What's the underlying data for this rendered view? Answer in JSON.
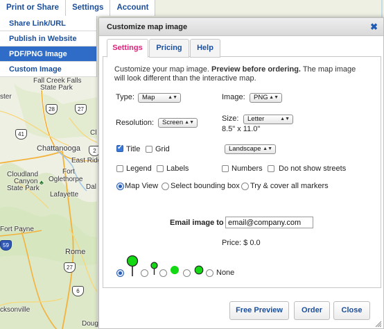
{
  "topnav": [
    "Print or Share",
    "Settings",
    "Account"
  ],
  "share_menu": [
    "Share Link/URL",
    "Publish in Website",
    "PDF/PNG Image",
    "Custom Image"
  ],
  "map_labels": {
    "fall_creek": "Fall Creek Falls",
    "state_park": "State Park",
    "ster": "ster",
    "chattanooga": "Chattanooga",
    "east_ridge": "East Ridg",
    "cloudland": "Cloudland",
    "canyon": "Canyon",
    "cloudland_park": "State Park",
    "fort": "Fort",
    "oglethorpe": "Oglethorpe",
    "dal": "Dal",
    "lafayette": "Lafayette",
    "fort_payne": "Fort Payne",
    "rome": "Rome",
    "cksonville": "cksonville",
    "doug": "Doug",
    "cl": "Cl",
    "shield_28": "28",
    "shield_27a": "27",
    "shield_41": "41",
    "shield_2": "2",
    "shield_59": "59",
    "shield_27b": "27",
    "shield_6": "6"
  },
  "dialog": {
    "title": "Customize map image",
    "close": "✖",
    "tabs": [
      "Settings",
      "Pricing",
      "Help"
    ],
    "intro_plain": "Customize your map image. ",
    "intro_bold": "Preview before ordering.",
    "intro_rest": " The map image will look different than the interactive map.",
    "type_label": "Type:",
    "type_value": "Map",
    "image_label": "Image:",
    "image_value": "PNG",
    "resolution_label": "Resolution:",
    "resolution_value": "Screen",
    "size_label": "Size:",
    "size_value": "Letter",
    "size_dims": "8.5\" x 11.0\"",
    "orientation_value": "Landscape",
    "checkbox_title": "Title",
    "checkbox_grid": "Grid",
    "checkbox_legend": "Legend",
    "checkbox_labels": "Labels",
    "checkbox_numbers": "Numbers",
    "checkbox_no_streets": "Do not show streets",
    "radio_map_view": "Map View",
    "radio_bounding_box": "Select bounding box",
    "radio_cover_markers": "Try & cover all markers",
    "email_label": "Email image to",
    "email_value": "email@company.com",
    "price_label": "Price: $ 0.0",
    "marker_none": "None",
    "buttons": [
      "Free Preview",
      "Order",
      "Close"
    ]
  },
  "colors": {
    "link_blue": "#1a4e9a",
    "active_tab_pink": "#e0207a",
    "menu_active": "#2f6cc7",
    "marker_green": "#13d813"
  }
}
